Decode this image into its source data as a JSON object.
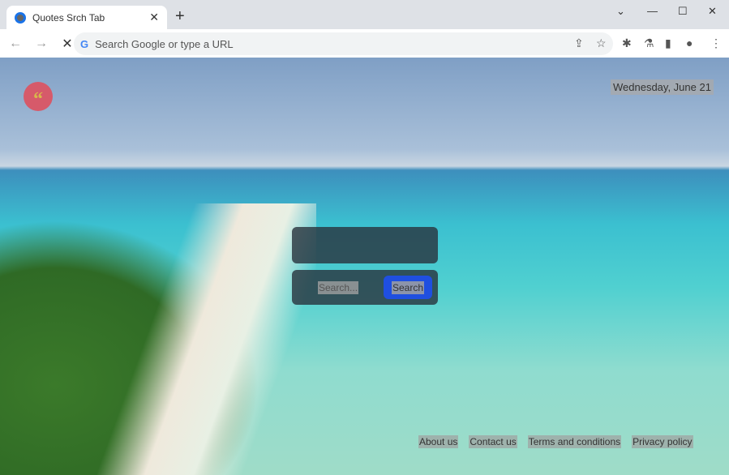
{
  "browser": {
    "tab_title": "Quotes Srch Tab",
    "omnibox_placeholder": "Search Google or type a URL",
    "google_g": "G"
  },
  "page": {
    "logo_glyph": "“",
    "date": "Wednesday, June 21",
    "search": {
      "placeholder": "Search...",
      "button": "Search"
    },
    "footer": [
      "About us",
      "Contact us",
      "Terms and conditions",
      "Privacy policy"
    ]
  }
}
